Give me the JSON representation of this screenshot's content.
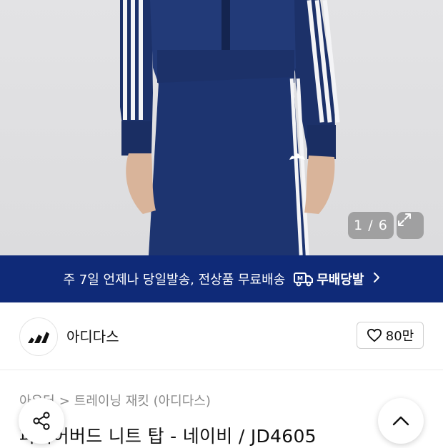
{
  "gallery": {
    "counter": "1 / 6",
    "expand_icon": "expand-icon"
  },
  "banner": {
    "text": "주 7일 언제나 당일발송, 전상품 무료배송",
    "service_name": "무배당발",
    "chevron_icon": "chevron-right-icon"
  },
  "brand": {
    "name": "아디다스",
    "like_count": "80만"
  },
  "breadcrumb": {
    "parent": "아우터",
    "separator": ">",
    "current": "트레이닝 재킷 (아디다스)"
  },
  "product": {
    "title": "파이어버드 니트 탑 - 네이비 / JD4605"
  },
  "colors": {
    "banner_bg": "#0f2a78",
    "garment_navy": "#1c3169"
  }
}
